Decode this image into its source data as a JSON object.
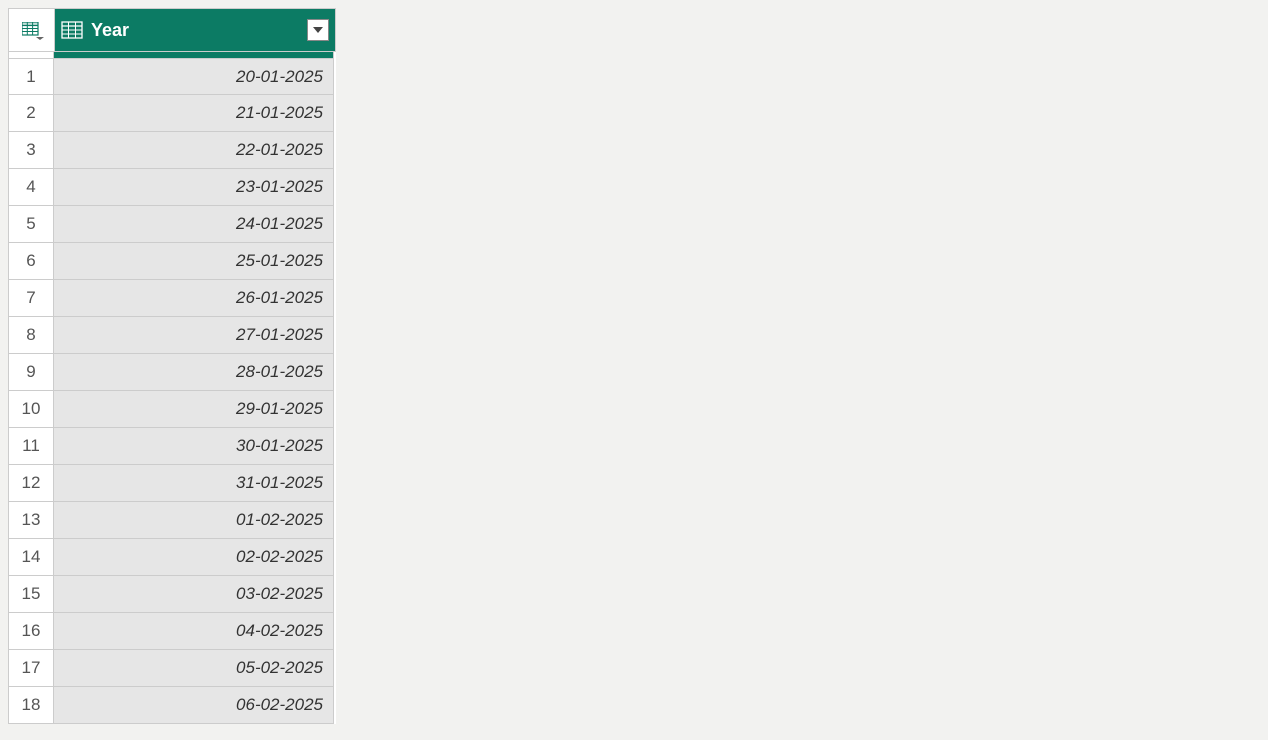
{
  "header": {
    "column_label": "Year"
  },
  "rows": [
    {
      "num": "1",
      "value": "20-01-2025"
    },
    {
      "num": "2",
      "value": "21-01-2025"
    },
    {
      "num": "3",
      "value": "22-01-2025"
    },
    {
      "num": "4",
      "value": "23-01-2025"
    },
    {
      "num": "5",
      "value": "24-01-2025"
    },
    {
      "num": "6",
      "value": "25-01-2025"
    },
    {
      "num": "7",
      "value": "26-01-2025"
    },
    {
      "num": "8",
      "value": "27-01-2025"
    },
    {
      "num": "9",
      "value": "28-01-2025"
    },
    {
      "num": "10",
      "value": "29-01-2025"
    },
    {
      "num": "11",
      "value": "30-01-2025"
    },
    {
      "num": "12",
      "value": "31-01-2025"
    },
    {
      "num": "13",
      "value": "01-02-2025"
    },
    {
      "num": "14",
      "value": "02-02-2025"
    },
    {
      "num": "15",
      "value": "03-02-2025"
    },
    {
      "num": "16",
      "value": "04-02-2025"
    },
    {
      "num": "17",
      "value": "05-02-2025"
    },
    {
      "num": "18",
      "value": "06-02-2025"
    }
  ]
}
